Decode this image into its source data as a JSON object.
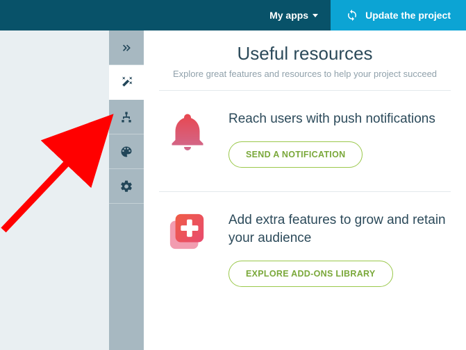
{
  "topbar": {
    "my_apps_label": "My apps",
    "update_label": "Update the project"
  },
  "content": {
    "title": "Useful resources",
    "subtitle": "Explore great features and resources to help your project succeed"
  },
  "cards": {
    "push": {
      "title": "Reach users with push notifications",
      "button": "SEND A NOTIFICATION"
    },
    "addons": {
      "title": "Add extra features to grow and retain your audience",
      "button": "EXPLORE ADD-ONS LIBRARY"
    }
  }
}
